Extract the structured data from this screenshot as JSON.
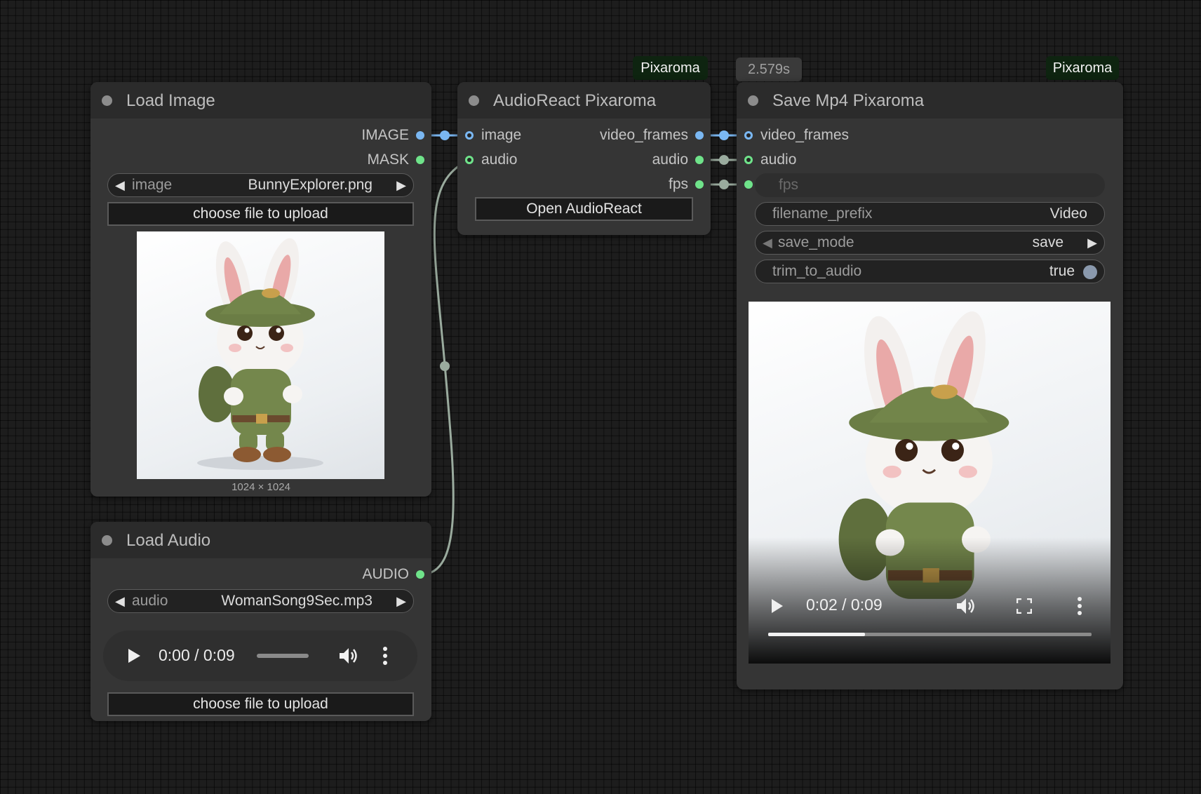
{
  "canvas": {
    "background": "#1d1d1d"
  },
  "badges": {
    "audio_react_brand": "Pixaroma",
    "execution_time": "2.579s",
    "save_mp4_brand": "Pixaroma"
  },
  "load_image": {
    "title": "Load Image",
    "outputs": [
      "IMAGE",
      "MASK"
    ],
    "image_widget": {
      "name": "image",
      "value": "BunnyExplorer.png"
    },
    "upload_label": "choose file to upload",
    "preview_caption": "1024 × 1024"
  },
  "load_audio": {
    "title": "Load Audio",
    "output": "AUDIO",
    "audio_widget": {
      "name": "audio",
      "value": "WomanSong9Sec.mp3"
    },
    "player": {
      "time": "0:00 / 0:09",
      "progress": 0
    },
    "upload_label": "choose file to upload"
  },
  "audio_react": {
    "title": "AudioReact Pixaroma",
    "inputs": [
      "image",
      "audio"
    ],
    "outputs": [
      "video_frames",
      "audio",
      "fps"
    ],
    "open_button": "Open AudioReact"
  },
  "save_mp4": {
    "title": "Save Mp4 Pixaroma",
    "inputs": [
      "video_frames",
      "audio"
    ],
    "fps_placeholder": "fps",
    "filename_prefix": {
      "name": "filename_prefix",
      "value": "Video"
    },
    "save_mode": {
      "name": "save_mode",
      "value": "save"
    },
    "trim_to_audio": {
      "name": "trim_to_audio",
      "value": "true"
    },
    "player": {
      "time": "0:02 / 0:09",
      "progress": 0.3
    }
  },
  "colors": {
    "image_slot": "#7ab7f2",
    "audio_slot": "#6fe38a",
    "wire_gray": "#9aab9e",
    "brand_bg": "#0e2410"
  }
}
